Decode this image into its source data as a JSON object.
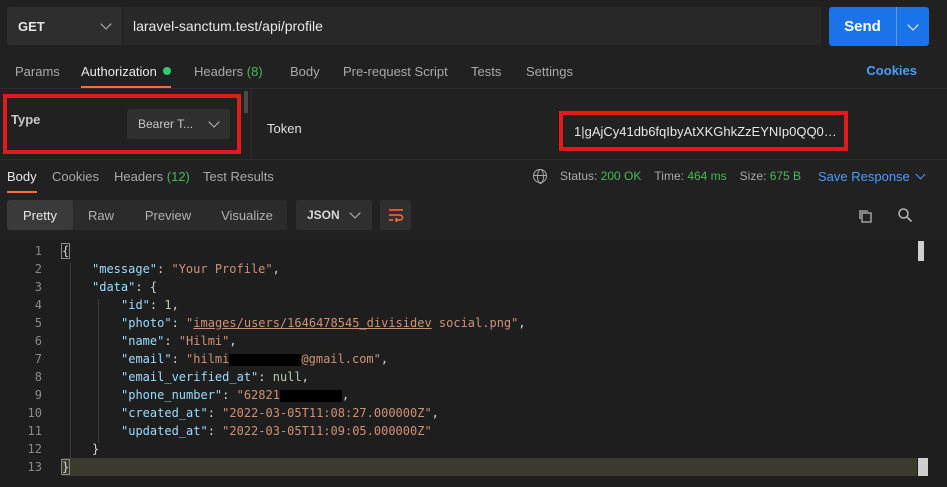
{
  "request": {
    "method": "GET",
    "url": "laravel-sanctum.test/api/profile",
    "send_label": "Send"
  },
  "req_tabs": {
    "params": "Params",
    "authorization": "Authorization",
    "headers": "Headers",
    "headers_count": "(8)",
    "body": "Body",
    "prerequest": "Pre-request Script",
    "tests": "Tests",
    "settings": "Settings",
    "cookies": "Cookies"
  },
  "auth": {
    "type_label": "Type",
    "type_value": "Bearer T...",
    "token_label": "Token",
    "token_value": "1|gAjCy41db6fqIbyAtXKGhkZzEYNIp0QQ0E..."
  },
  "response_tabs": {
    "body": "Body",
    "cookies": "Cookies",
    "headers": "Headers",
    "headers_count": "(12)",
    "test_results": "Test Results"
  },
  "status": {
    "status_label": "Status:",
    "status_value": "200 OK",
    "time_label": "Time:",
    "time_value": "464 ms",
    "size_label": "Size:",
    "size_value": "675 B",
    "save_response": "Save Response"
  },
  "view": {
    "pretty": "Pretty",
    "raw": "Raw",
    "preview": "Preview",
    "visualize": "Visualize",
    "format": "JSON"
  },
  "code": {
    "line_numbers": [
      "1",
      "2",
      "3",
      "4",
      "5",
      "6",
      "7",
      "8",
      "9",
      "10",
      "11",
      "12",
      "13"
    ],
    "open_brace": "{",
    "close_brace": "}",
    "message_key": "\"message\"",
    "message_val": "\"Your Profile\"",
    "data_key": "\"data\"",
    "id_key": "\"id\"",
    "id_val": "1",
    "photo_key": "\"photo\"",
    "photo_q1": "\"",
    "photo_path": "images/users/1646478545_divisidev",
    "photo_rest": " social.png\"",
    "name_key": "\"name\"",
    "name_val": "\"Hilmi\"",
    "email_key": "\"email\"",
    "email_pre": "\"hilmi",
    "email_post": "@gmail.com\"",
    "verified_key": "\"email_verified_at\"",
    "verified_val": "null",
    "phone_key": "\"phone_number\"",
    "phone_pre": "\"62821",
    "created_key": "\"created_at\"",
    "created_val": "\"2022-03-05T11:08:27.000000Z\"",
    "updated_key": "\"updated_at\"",
    "updated_val": "\"2022-03-05T11:09:05.000000Z\""
  },
  "colors": {
    "accent": "#ff6c37",
    "send": "#1a73e8",
    "link": "#4a9eff",
    "ok": "#49b85a",
    "highlight_red": "#e01b1b"
  }
}
